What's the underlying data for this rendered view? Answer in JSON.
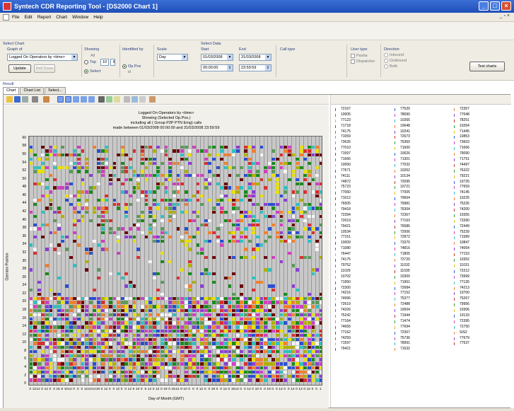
{
  "window": {
    "title": "Syntech CDR Reporting Tool - [DS2000 Chart 1]"
  },
  "menu": [
    "File",
    "Edit",
    "Report",
    "Chart",
    "Window",
    "Help"
  ],
  "select_chart": {
    "section_label": "Select Chart",
    "graph_of_label": "Graph of",
    "graph_of_value": "Logged On Operators by <time>",
    "update_label": "Update",
    "drill_down_label": "Drill Down",
    "showing_label": "Showing",
    "all_label": "All",
    "top_label": "Top",
    "top_value": "10",
    "select_label": "Select",
    "identified_by_label": "Identified by",
    "op_pos_label": "Op.Pos",
    "id_label": "id",
    "scale_label": "Scale",
    "scale_value": "Day"
  },
  "select_data": {
    "section_label": "Select Data",
    "start_label": "Start",
    "start_date": "01/03/2008",
    "start_time": "00:00:00",
    "end_label": "End",
    "end_date": "31/03/2008",
    "end_time": "23:59:59",
    "call_type_label": "Call type",
    "user_type_label": "User type",
    "pasha_label": "Pasha",
    "dispatcher_label": "Dispatcher",
    "direction_label": "Direction",
    "inbound_label": "Inbound",
    "outbound_label": "Outbound",
    "both_label": "Both",
    "test_charts_label": "Test charts"
  },
  "result": {
    "label": "Result",
    "tabs": [
      "Chart",
      "Chart List",
      "Select..."
    ]
  },
  "chart_data": {
    "type": "heatmap",
    "title": "Logged On Operators by <time>",
    "subtitle_lines": [
      "Showing (Selected Op.Pos.)",
      "including all ( Group P2P PTN Emg) calls",
      "made between 01/03/2008 00:00:00 and 31/03/2008 23:59:59"
    ],
    "xlabel": "Day of Month (GMT)",
    "ylabel": "Operator Position",
    "y_ticks": [
      0,
      2,
      4,
      6,
      8,
      10,
      12,
      14,
      16,
      18,
      20,
      22,
      24,
      26,
      28,
      30,
      32,
      34,
      36,
      38,
      40,
      42,
      44,
      46,
      48,
      50,
      52,
      54,
      56,
      58,
      60
    ],
    "ylim": [
      0,
      60
    ],
    "x_ticks": [
      "0",
      "12",
      "12",
      "0",
      "12",
      "0",
      "0",
      "15",
      "6",
      "10",
      "12",
      "0",
      "0",
      "0",
      "12",
      "10",
      "14",
      "19",
      "0",
      "12",
      "0",
      "0",
      "12",
      "0",
      "0",
      "12",
      "6",
      "10",
      "0",
      "5",
      "12",
      "0",
      "12",
      "0",
      "19",
      "0",
      "15",
      "12",
      "8",
      "10",
      "0",
      "0",
      "0",
      "12",
      "0",
      "0",
      "19",
      "0",
      "0",
      "12",
      "0",
      "15",
      "12",
      "0",
      "0",
      "12",
      "0",
      "10",
      "0",
      "0",
      "18",
      "0",
      "0",
      "12",
      "0",
      "0",
      "12",
      "0",
      "12",
      "0",
      "12",
      "0",
      "0",
      "1"
    ],
    "grid": true,
    "legend": "right",
    "palette": [
      "#6a0a0a",
      "#e8e000",
      "#d83030",
      "#1c8a1c",
      "#2a4fd0",
      "#f5f5f5",
      "#d040c0",
      "#30c0c0",
      "#f08030",
      "#8a40d0",
      "#5a9a5a",
      "#b0b000"
    ]
  },
  "operator_list": {
    "col1": [
      "72167",
      "10005",
      "77123",
      "71718",
      "74175",
      "71059",
      "73626",
      "77010",
      "71597",
      "71666",
      "10050",
      "77671",
      "74111",
      "74872",
      "75723",
      "77060",
      "71012",
      "76505",
      "79418",
      "72394",
      "72619",
      "79421",
      "10534",
      "77151",
      "10009",
      "71080",
      "76447",
      "74175",
      "79752",
      "11029",
      "10702",
      "71950",
      "72300",
      "74216",
      "74996",
      "72619",
      "74326",
      "75242",
      "77164",
      "74656",
      "77162",
      "74259",
      "71597",
      "79421"
    ],
    "col2": [
      "77520",
      "78690",
      "10265",
      "10648",
      "10241",
      "72673",
      "75360",
      "71600",
      "10626",
      "71301",
      "77032",
      "10262",
      "10134",
      "72095",
      "10721",
      "77005",
      "79664",
      "79981",
      "76304",
      "72367",
      "77163",
      "76586",
      "72006",
      "72872",
      "73370",
      "74816",
      "71805",
      "72720",
      "11032",
      "11030",
      "10300",
      "71961",
      "72684",
      "77152",
      "75377",
      "72488",
      "10004",
      "71944",
      "71474",
      "77694",
      "72367",
      "75736",
      "78991",
      "71632"
    ],
    "col3": [
      "72357",
      "77648",
      "78251",
      "10264",
      "71445",
      "10853",
      "73603",
      "71666",
      "79090",
      "71751",
      "74497",
      "76322",
      "79221",
      "10726",
      "77659",
      "74145",
      "10225",
      "75226",
      "74200",
      "10355",
      "73390",
      "72449",
      "75239",
      "71589",
      "10847",
      "74064",
      "77153",
      "10352",
      "11031",
      "72212",
      "73999",
      "77135",
      "74213",
      "10700",
      "75267",
      "79956",
      "10306",
      "10133",
      "72395",
      "72750",
      "SIS2",
      "77679",
      "77537"
    ]
  }
}
